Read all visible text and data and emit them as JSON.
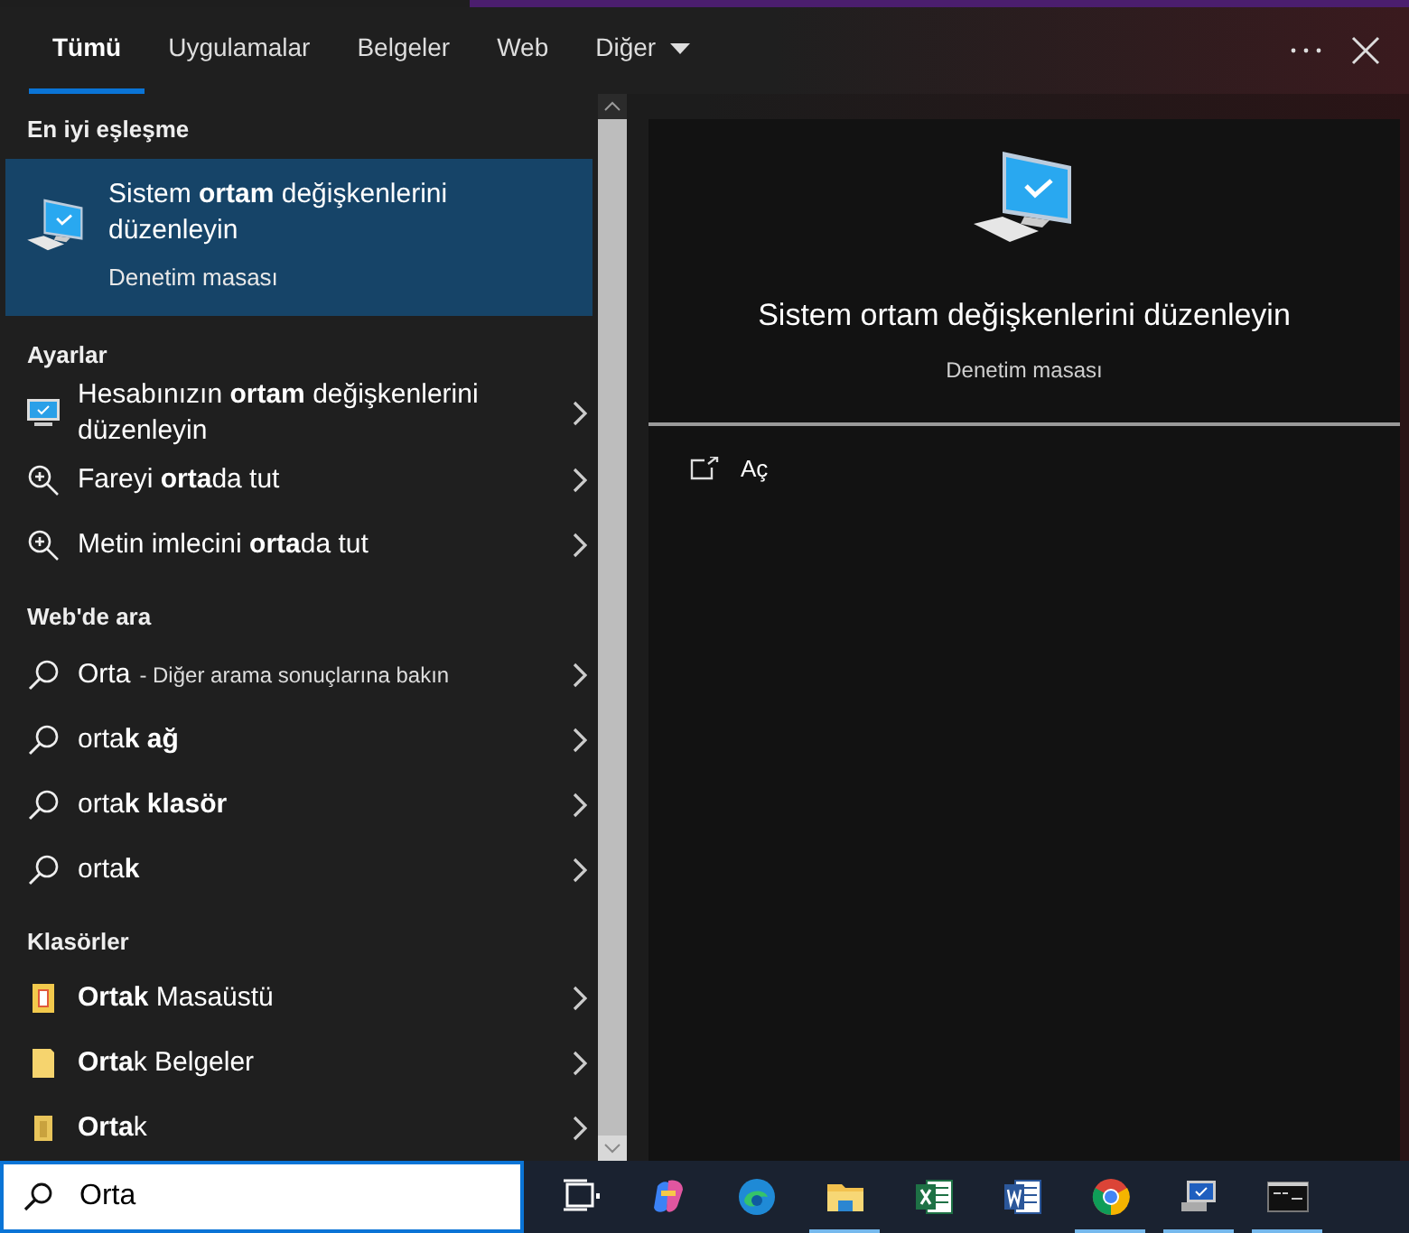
{
  "tabs": [
    {
      "label": "Tümü",
      "selected": true,
      "kind": "tab"
    },
    {
      "label": "Uygulamalar",
      "selected": false,
      "kind": "tab"
    },
    {
      "label": "Belgeler",
      "selected": false,
      "kind": "tab"
    },
    {
      "label": "Web",
      "selected": false,
      "kind": "tab"
    },
    {
      "label": "Diğer",
      "selected": false,
      "kind": "menu"
    }
  ],
  "best_match": {
    "heading": "En iyi eşleşme",
    "title": "Sistem **ortam** değişkenlerini düzenleyin",
    "subtitle": "Denetim masası",
    "selected": true
  },
  "sections": [
    {
      "heading": "Ayarlar",
      "items": [
        {
          "kind": "monitor",
          "text": "Hesabınızın **ortam** değişkenlerini düzenleyin"
        },
        {
          "kind": "magnifier",
          "text": "Fareyi **orta**da tut"
        },
        {
          "kind": "magnifier",
          "text": "Metin imlecini **orta**da tut"
        }
      ]
    },
    {
      "heading": "Web'de ara",
      "items": [
        {
          "kind": "search",
          "text": "Orta",
          "hint": "- Diğer arama sonuçlarına bakın"
        },
        {
          "kind": "search",
          "text": "orta**k ağ**"
        },
        {
          "kind": "search",
          "text": "orta**k klasör**"
        },
        {
          "kind": "search",
          "text": "orta**k**"
        }
      ]
    },
    {
      "heading": "Klasörler",
      "items": [
        {
          "kind": "folder-desktop",
          "text": "**Ortak** Masaüstü"
        },
        {
          "kind": "folder",
          "text": "**Orta**k Belgeler"
        },
        {
          "kind": "folder-narrow",
          "text": "**Orta**k"
        }
      ]
    }
  ],
  "preview": {
    "title": "Sistem ortam değişkenlerini düzenleyin",
    "subtitle": "Denetim masası",
    "actions": [
      {
        "label": "Aç"
      }
    ]
  },
  "search": {
    "value": "Orta"
  },
  "taskbar": [
    {
      "kind": "task-view",
      "running": false
    },
    {
      "kind": "copilot",
      "running": false
    },
    {
      "kind": "edge",
      "running": false
    },
    {
      "kind": "explorer",
      "running": true
    },
    {
      "kind": "excel",
      "running": false
    },
    {
      "kind": "word",
      "running": false
    },
    {
      "kind": "chrome",
      "running": true
    },
    {
      "kind": "remote",
      "running": true
    },
    {
      "kind": "terminal",
      "running": true
    }
  ]
}
